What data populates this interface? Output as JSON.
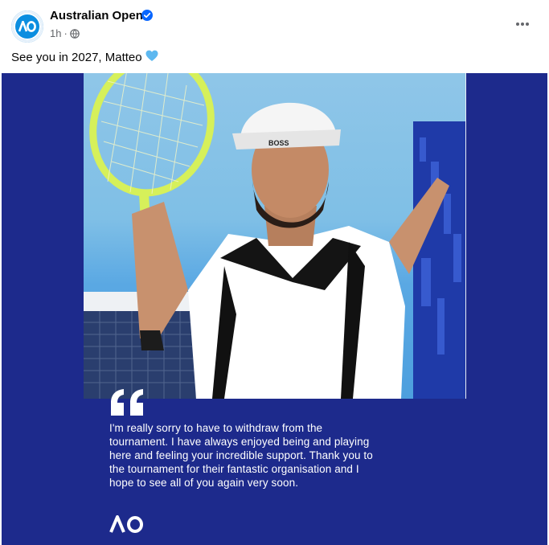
{
  "post": {
    "page_name": "Australian Open",
    "time": "1h",
    "separator": "·",
    "caption": "See you in 2027, Matteo",
    "caption_emoji": "💙"
  },
  "media": {
    "quote_text": "I'm really sorry to have to withdraw from the\ntournament. I have always enjoyed being and playing\nhere and feeling your incredible support. Thank you to\nthe tournament for their fantastic organisation and I\nhope to see all of you again very soon.",
    "logo_text": "AO",
    "cap_brand": "BOSS",
    "colors": {
      "background": "#1d2a8c",
      "accent": "#0b8ee0"
    }
  },
  "icons": {
    "verified": "verified-badge-icon",
    "privacy": "globe-icon",
    "more": "more-options-icon",
    "avatar": "ao-logo-icon"
  }
}
